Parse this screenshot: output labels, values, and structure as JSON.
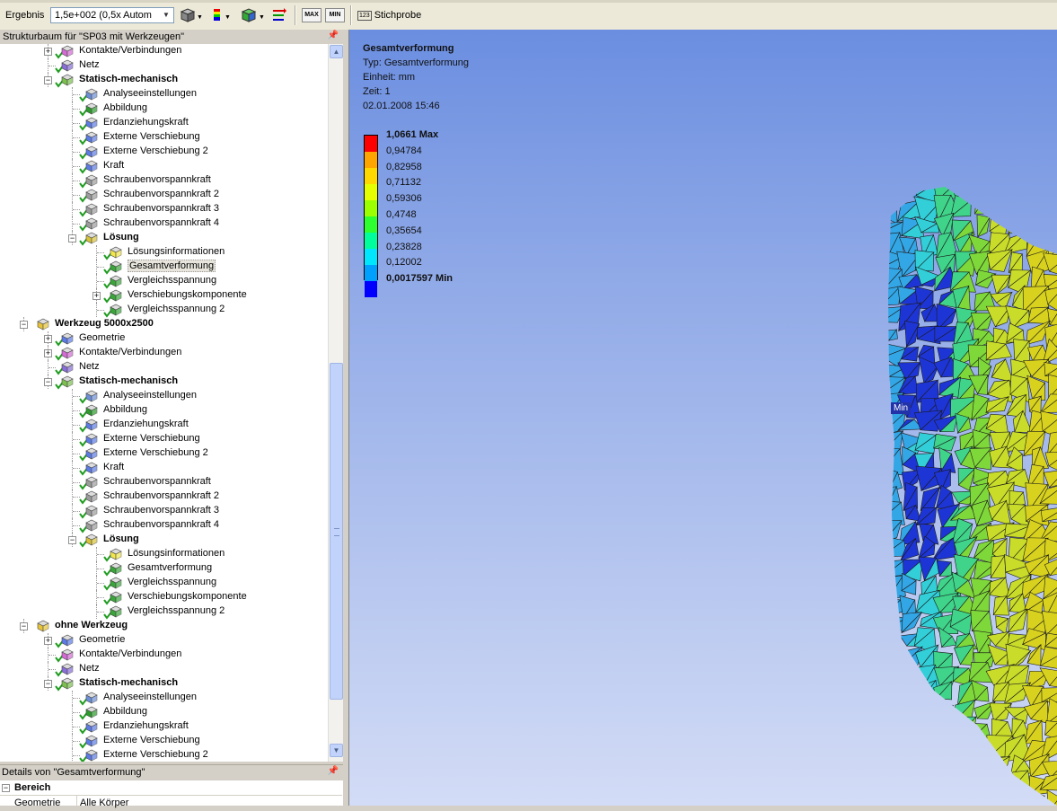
{
  "toolbar": {
    "result_label": "Ergebnis",
    "scale_value": "1,5e+002 (0,5x Autom",
    "max_label": "MAX",
    "min_label": "MIN",
    "probe_label": "Stichprobe"
  },
  "tree": {
    "header": "Strukturbaum für \"SP03 mit Werkzeugen\"",
    "items": [
      {
        "label": "Kontakte/Verbindungen",
        "level": 2,
        "expander": "+",
        "icon": "contacts",
        "bold": false,
        "check": true
      },
      {
        "label": "Netz",
        "level": 2,
        "expander": "",
        "icon": "mesh",
        "bold": false,
        "check": true
      },
      {
        "label": "Statisch-mechanisch",
        "level": 2,
        "expander": "-",
        "icon": "static",
        "bold": true,
        "check": true
      },
      {
        "label": "Analyseeinstellungen",
        "level": 3,
        "expander": "",
        "icon": "analysis",
        "bold": false,
        "check": true
      },
      {
        "label": "Abbildung",
        "level": 3,
        "expander": "",
        "icon": "figure",
        "bold": false,
        "check": true
      },
      {
        "label": "Erdanziehungskraft",
        "level": 3,
        "expander": "",
        "icon": "gravity",
        "bold": false,
        "check": true
      },
      {
        "label": "Externe Verschiebung",
        "level": 3,
        "expander": "",
        "icon": "displacement",
        "bold": false,
        "check": true
      },
      {
        "label": "Externe Verschiebung 2",
        "level": 3,
        "expander": "",
        "icon": "displacement",
        "bold": false,
        "check": true
      },
      {
        "label": "Kraft",
        "level": 3,
        "expander": "",
        "icon": "force",
        "bold": false,
        "check": true
      },
      {
        "label": "Schraubenvorspannkraft",
        "level": 3,
        "expander": "",
        "icon": "bolt",
        "bold": false,
        "check": true
      },
      {
        "label": "Schraubenvorspannkraft 2",
        "level": 3,
        "expander": "",
        "icon": "bolt",
        "bold": false,
        "check": true
      },
      {
        "label": "Schraubenvorspannkraft 3",
        "level": 3,
        "expander": "",
        "icon": "bolt",
        "bold": false,
        "check": true
      },
      {
        "label": "Schraubenvorspannkraft 4",
        "level": 3,
        "expander": "",
        "icon": "bolt",
        "bold": false,
        "check": true
      },
      {
        "label": "Lösung",
        "level": 3,
        "expander": "-",
        "icon": "solution",
        "bold": true,
        "check": true
      },
      {
        "label": "Lösungsinformationen",
        "level": 4,
        "expander": "",
        "icon": "info",
        "bold": false,
        "check": true
      },
      {
        "label": "Gesamtverformung",
        "level": 4,
        "expander": "",
        "icon": "result",
        "bold": false,
        "check": true,
        "selected": true
      },
      {
        "label": "Vergleichsspannung",
        "level": 4,
        "expander": "",
        "icon": "result",
        "bold": false,
        "check": true
      },
      {
        "label": "Verschiebungskomponente",
        "level": 4,
        "expander": "+",
        "icon": "result",
        "bold": false,
        "check": true
      },
      {
        "label": "Vergleichsspannung 2",
        "level": 4,
        "expander": "",
        "icon": "result",
        "bold": false,
        "check": true
      },
      {
        "label": "Werkzeug 5000x2500",
        "level": 1,
        "expander": "-",
        "icon": "model",
        "bold": true,
        "check": false
      },
      {
        "label": "Geometrie",
        "level": 2,
        "expander": "+",
        "icon": "geometry",
        "bold": false,
        "check": true
      },
      {
        "label": "Kontakte/Verbindungen",
        "level": 2,
        "expander": "+",
        "icon": "contacts",
        "bold": false,
        "check": true
      },
      {
        "label": "Netz",
        "level": 2,
        "expander": "",
        "icon": "mesh",
        "bold": false,
        "check": true
      },
      {
        "label": "Statisch-mechanisch",
        "level": 2,
        "expander": "-",
        "icon": "static",
        "bold": true,
        "check": true
      },
      {
        "label": "Analyseeinstellungen",
        "level": 3,
        "expander": "",
        "icon": "analysis",
        "bold": false,
        "check": true
      },
      {
        "label": "Abbildung",
        "level": 3,
        "expander": "",
        "icon": "figure",
        "bold": false,
        "check": true
      },
      {
        "label": "Erdanziehungskraft",
        "level": 3,
        "expander": "",
        "icon": "gravity",
        "bold": false,
        "check": true
      },
      {
        "label": "Externe Verschiebung",
        "level": 3,
        "expander": "",
        "icon": "displacement",
        "bold": false,
        "check": true
      },
      {
        "label": "Externe Verschiebung 2",
        "level": 3,
        "expander": "",
        "icon": "displacement",
        "bold": false,
        "check": true
      },
      {
        "label": "Kraft",
        "level": 3,
        "expander": "",
        "icon": "force",
        "bold": false,
        "check": true
      },
      {
        "label": "Schraubenvorspannkraft",
        "level": 3,
        "expander": "",
        "icon": "bolt",
        "bold": false,
        "check": true
      },
      {
        "label": "Schraubenvorspannkraft 2",
        "level": 3,
        "expander": "",
        "icon": "bolt",
        "bold": false,
        "check": true
      },
      {
        "label": "Schraubenvorspannkraft 3",
        "level": 3,
        "expander": "",
        "icon": "bolt",
        "bold": false,
        "check": true
      },
      {
        "label": "Schraubenvorspannkraft 4",
        "level": 3,
        "expander": "",
        "icon": "bolt",
        "bold": false,
        "check": true
      },
      {
        "label": "Lösung",
        "level": 3,
        "expander": "-",
        "icon": "solution",
        "bold": true,
        "check": true
      },
      {
        "label": "Lösungsinformationen",
        "level": 4,
        "expander": "",
        "icon": "info",
        "bold": false,
        "check": true
      },
      {
        "label": "Gesamtverformung",
        "level": 4,
        "expander": "",
        "icon": "result",
        "bold": false,
        "check": true
      },
      {
        "label": "Vergleichsspannung",
        "level": 4,
        "expander": "",
        "icon": "result",
        "bold": false,
        "check": true
      },
      {
        "label": "Verschiebungskomponente",
        "level": 4,
        "expander": "",
        "icon": "result",
        "bold": false,
        "check": true
      },
      {
        "label": "Vergleichsspannung 2",
        "level": 4,
        "expander": "",
        "icon": "result",
        "bold": false,
        "check": true
      },
      {
        "label": "ohne Werkzeug",
        "level": 1,
        "expander": "-",
        "icon": "model",
        "bold": true,
        "check": false
      },
      {
        "label": "Geometrie",
        "level": 2,
        "expander": "+",
        "icon": "geometry",
        "bold": false,
        "check": true
      },
      {
        "label": "Kontakte/Verbindungen",
        "level": 2,
        "expander": "",
        "icon": "contacts",
        "bold": false,
        "check": true
      },
      {
        "label": "Netz",
        "level": 2,
        "expander": "",
        "icon": "mesh",
        "bold": false,
        "check": true
      },
      {
        "label": "Statisch-mechanisch",
        "level": 2,
        "expander": "-",
        "icon": "static",
        "bold": true,
        "check": true
      },
      {
        "label": "Analyseeinstellungen",
        "level": 3,
        "expander": "",
        "icon": "analysis",
        "bold": false,
        "check": true
      },
      {
        "label": "Abbildung",
        "level": 3,
        "expander": "",
        "icon": "figure",
        "bold": false,
        "check": true
      },
      {
        "label": "Erdanziehungskraft",
        "level": 3,
        "expander": "",
        "icon": "gravity",
        "bold": false,
        "check": true
      },
      {
        "label": "Externe Verschiebung",
        "level": 3,
        "expander": "",
        "icon": "displacement",
        "bold": false,
        "check": true
      },
      {
        "label": "Externe Verschiebung 2",
        "level": 3,
        "expander": "",
        "icon": "displacement",
        "bold": false,
        "check": true
      }
    ]
  },
  "details": {
    "header": "Details von \"Gesamtverformung\"",
    "section": "Bereich",
    "row_name": "Geometrie",
    "row_value": "Alle Körper"
  },
  "viewport": {
    "title": "Gesamtverformung",
    "type_line": "Typ: Gesamtverformung",
    "unit_line": "Einheit: mm",
    "time_line": "Zeit: 1",
    "date_line": "02.01.2008 15:46",
    "min_tag": "Min"
  },
  "legend": {
    "labels": [
      "1,0661 Max",
      "0,94784",
      "0,82958",
      "0,71132",
      "0,59306",
      "0,4748",
      "0,35654",
      "0,23828",
      "0,12002",
      "0,0017597 Min"
    ],
    "colors": [
      "#ff0000",
      "#ffa500",
      "#ffd800",
      "#e6ff00",
      "#9cff00",
      "#2eff2e",
      "#00ff9c",
      "#00e6ff",
      "#00a0ff",
      "#0000ff"
    ]
  }
}
